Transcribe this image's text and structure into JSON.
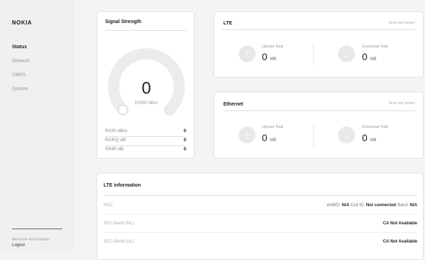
{
  "brand": {
    "logo": "NOKIA"
  },
  "sidebar": {
    "items": [
      {
        "label": "Status"
      },
      {
        "label": "Network"
      },
      {
        "label": "CBRS"
      },
      {
        "label": "System"
      }
    ],
    "welcome": "Welcome fm2-installer",
    "logout": "Logout"
  },
  "signal": {
    "title": "Signal Strength",
    "gauge_value": "0",
    "gauge_unit": "RSRP dBm",
    "rows": [
      {
        "label": "RSSI dBm",
        "value": "0"
      },
      {
        "label": "RSRQ dB",
        "value": "0"
      },
      {
        "label": "SINR dB",
        "value": "0"
      }
    ]
  },
  "lte": {
    "title": "LTE",
    "since": "Since last restart",
    "upload_label": "Upload Total",
    "upload_value": "0",
    "upload_unit": "MB",
    "download_label": "Download Total",
    "download_value": "0",
    "download_unit": "MB"
  },
  "ethernet": {
    "title": "Ethernet",
    "since": "Since last restart",
    "upload_label": "Upload Total",
    "upload_value": "0",
    "upload_unit": "MB",
    "download_label": "Download Total",
    "download_value": "0",
    "download_unit": "MB"
  },
  "lte_info": {
    "title": "LTE information",
    "rows": [
      {
        "label": "PCC",
        "enbid_label": "eNBID:",
        "enbid_value": "N/A",
        "cellid_label": "Cell ID:",
        "cellid_value": "Not connected",
        "band_label": "Band:",
        "band_value": "N/A"
      },
      {
        "label": "SCC Band (DL)",
        "value": "CA Not Available"
      },
      {
        "label": "SCC Band (UL)",
        "value": "CA Not Available"
      }
    ]
  },
  "icons": {
    "upload": "arrow-up-icon",
    "download": "arrow-down-icon"
  },
  "colors": {
    "icon_circle": "#e8e8e8",
    "gauge_track": "#ececec"
  }
}
